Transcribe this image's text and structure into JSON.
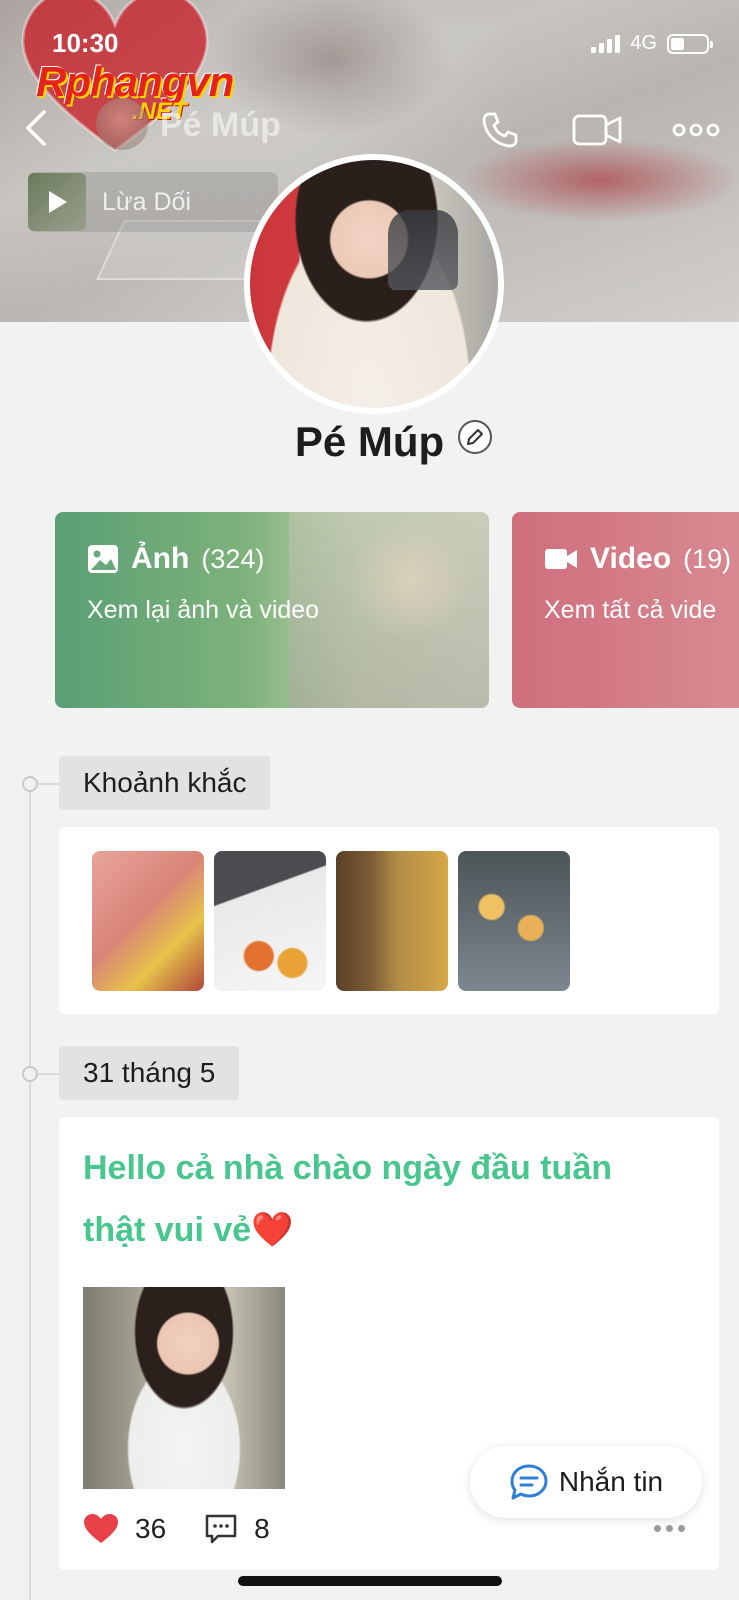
{
  "status_bar": {
    "time": "10:30",
    "network": "4G",
    "battery_level": 0.25
  },
  "watermark": {
    "brand": "Rphangvn",
    "suffix": ".NET"
  },
  "header": {
    "name": "Pé Múp",
    "icons": [
      "back-icon",
      "phone-icon",
      "video-call-icon",
      "more-icon"
    ]
  },
  "music": {
    "label": "Lừa Dối"
  },
  "profile": {
    "name": "Pé Múp"
  },
  "albums": [
    {
      "title": "Ảnh",
      "count": "(324)",
      "subtitle": "Xem lại ảnh và video",
      "icon": "image-icon",
      "color": "#5a9f74"
    },
    {
      "title": "Video",
      "count": "(19)",
      "subtitle": "Xem tất cả vide",
      "icon": "video-icon",
      "color": "#d06e7d"
    }
  ],
  "moments": {
    "label": "Khoảnh khắc"
  },
  "post": {
    "date": "31 tháng 5",
    "text": "Hello cả nhà chào ngày đầu tuần thật vui vẻ❤️",
    "likes": "36",
    "comments": "8"
  },
  "message_button": {
    "label": "Nhắn tin"
  },
  "colors": {
    "accent_green": "#48c68e",
    "heart_red": "#e8414a",
    "background": "#f1f3f2"
  }
}
